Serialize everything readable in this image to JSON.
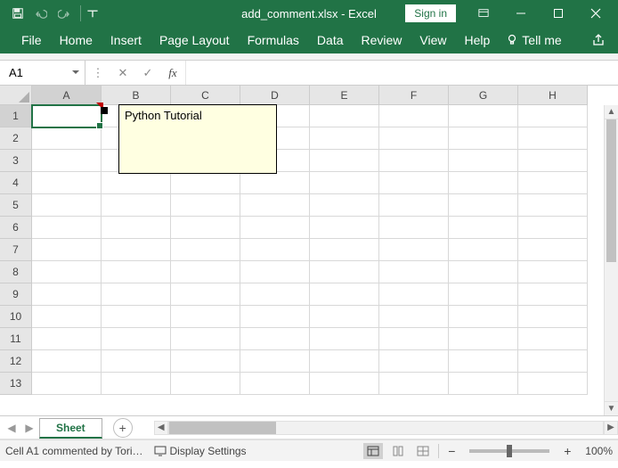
{
  "title": "add_comment.xlsx - Excel",
  "signin_label": "Sign in",
  "ribbon": {
    "tabs": [
      "File",
      "Home",
      "Insert",
      "Page Layout",
      "Formulas",
      "Data",
      "Review",
      "View",
      "Help"
    ],
    "tell_me": "Tell me"
  },
  "formula_bar": {
    "name_box": "A1",
    "fx_label": "fx",
    "formula_value": ""
  },
  "grid": {
    "columns": [
      "A",
      "B",
      "C",
      "D",
      "E",
      "F",
      "G",
      "H"
    ],
    "rows_visible": 13,
    "selected_cell": "A1"
  },
  "comment": {
    "text": "Python Tutorial"
  },
  "tabbar": {
    "sheet_name": "Sheet"
  },
  "statusbar": {
    "message": "Cell A1 commented by Tori…",
    "display_settings_label": "Display Settings",
    "zoom_label": "100%"
  }
}
